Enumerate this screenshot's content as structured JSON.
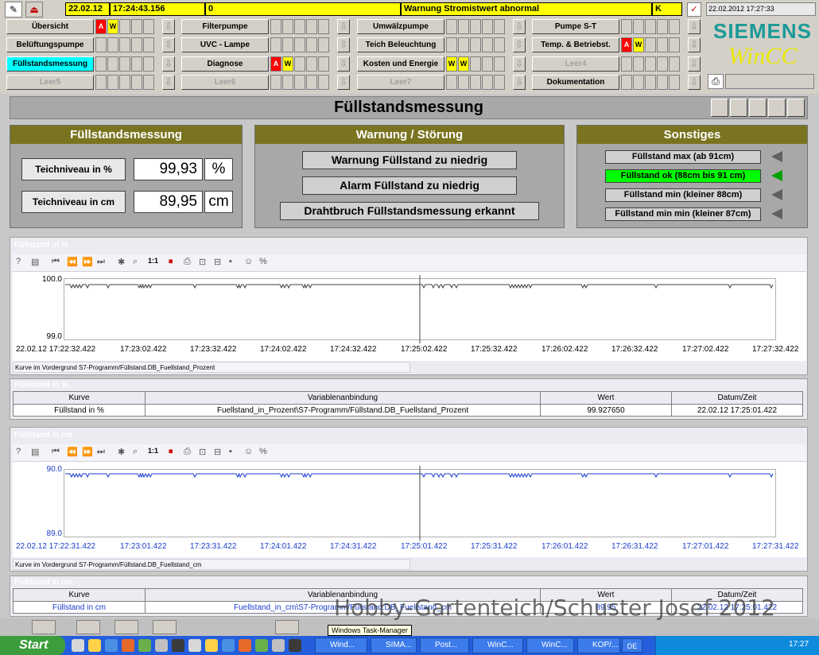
{
  "alarmline": {
    "date": "22.02.12",
    "time": "17:24:43.156",
    "number": "0",
    "message": "Warnung Stromistwert abnormal",
    "class": "K",
    "datetime": "22.02.2012 17:27:33"
  },
  "nav": {
    "row1": [
      "Übersicht",
      "Filterpumpe",
      "Umwälzpumpe",
      "Pumpe S-T"
    ],
    "row2": [
      "Belüftungspumpe",
      "UVC - Lampe",
      "Teich Beleuchtung",
      "Temp. & Betriebst."
    ],
    "row3": [
      "Füllstandsmessung",
      "Diagnose",
      "Kosten und Energie",
      "Leer4"
    ],
    "row4": [
      "Leer5",
      "Leer6",
      "Leer7",
      "Dokumentation"
    ]
  },
  "logo": {
    "brand": "SIEMENS",
    "product": "WinCC"
  },
  "badges": {
    "a": "A",
    "w": "W"
  },
  "page_title": "Füllstandsmessung",
  "fuellstand_panel": {
    "title": "Füllstandsmessung",
    "label_percent": "Teichniveau in %",
    "value_percent": "99,93",
    "unit_percent": "%",
    "label_cm": "Teichniveau in cm",
    "value_cm": "89,95",
    "unit_cm": "cm"
  },
  "warnung_panel": {
    "title": "Warnung / Störung",
    "items": [
      "Warnung Füllstand zu niedrig",
      "Alarm Füllstand zu niedrig",
      "Drahtbruch Füllstandsmessung erkannt"
    ]
  },
  "sonstiges_panel": {
    "title": "Sonstiges",
    "items": [
      "Füllstand max (ab 91cm)",
      "Füllstand ok (88cm bis 91 cm)",
      "Füllstand min (kleiner 88cm)",
      "Füllstand min min (kleiner 87cm)"
    ],
    "active_index": 1
  },
  "trend1": {
    "title": "Füllstand in %",
    "ymax": "100.0",
    "ymin": "99.0",
    "ticks": [
      "22.02.12  17:22:32.422",
      "17:23:02.422",
      "17:23:32.422",
      "17:24:02.422",
      "17:24:32.422",
      "17:25:02.422",
      "17:25:32.422",
      "17:26:02.422",
      "17:26:32.422",
      "17:27:02.422",
      "17:27:32.422"
    ],
    "status": "Kurve im Vordergrund S7-Programm/Füllstand.DB_Fuellstand_Prozent",
    "table_title": "Füllstand in %",
    "columns": [
      "Kurve",
      "Variablenanbindung",
      "Wert",
      "Datum/Zeit"
    ],
    "row": [
      "Füllstand in %",
      "Fuellstand_in_Prozent\\S7-Programm/Füllstand.DB_Fuellstand_Prozent",
      "99.927650",
      "22.02.12 17:25:01.422"
    ]
  },
  "trend2": {
    "title": "Füllstand in cm",
    "ymax": "90.0",
    "ymin": "89.0",
    "ticks": [
      "22.02.12  17:22:31.422",
      "17:23:01.422",
      "17:23:31.422",
      "17:24:01.422",
      "17:24:31.422",
      "17:25:01.422",
      "17:25:31.422",
      "17:26:01.422",
      "17:26:31.422",
      "17:27:01.422",
      "17:27:31.422"
    ],
    "status": "Kurve im Vordergrund S7-Programm/Füllstand.DB_Fuellstand_cm",
    "table_title": "Füllstand in cm",
    "columns": [
      "Kurve",
      "Variablenanbindung",
      "Wert",
      "Datum/Zeit"
    ],
    "row": [
      "Füllstand in cm",
      "Fuellstand_in_cm\\S7-Programm/Füllstand.DB_Fuellstand_cm",
      "89.95",
      "22.02.12 17:25:01.422"
    ]
  },
  "toolbar_zoom_label": "1:1",
  "tooltip": "Windows Task-Manager",
  "watermark": "Hobby-Gartenteich/Schuster Josef 2012",
  "taskbar": {
    "start": "Start",
    "tasks": [
      "Wind...",
      "SIMA...",
      "Post...",
      "WinC...",
      "WinC...",
      "KOP/..."
    ],
    "lang": "DE",
    "clock": "17:27"
  },
  "colors": {
    "alarm_yellow": "#ffff00",
    "active_cyan": "#00ffff",
    "ok_green": "#00ff00",
    "header_olive": "#7a7420",
    "trend2_blue": "#1a3ccc"
  }
}
